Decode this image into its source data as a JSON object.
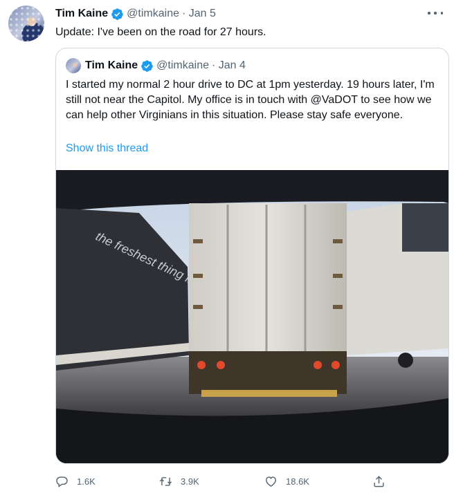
{
  "tweet": {
    "author_name": "Tim Kaine",
    "handle": "@timkaine",
    "date": "· Jan 5",
    "text": "Update: I've been on the road for 27 hours."
  },
  "quoted": {
    "author_name": "Tim Kaine",
    "handle": "@timkaine",
    "date": "· Jan 4",
    "text": "I started my normal 2 hour drive to DC at 1pm yesterday. 19 hours later, I'm still not near the Capitol. My office is in touch with @VaDOT to see how we can help other Virginians in this situation. Please stay safe everyone.",
    "link": "Show this thread",
    "image_text": "the freshest thing in fresh mushrooms"
  },
  "actions": {
    "replies": "1.6K",
    "retweets": "3.9K",
    "likes": "18.6K"
  },
  "icons": [
    "verified-badge-icon",
    "more-icon",
    "reply-icon",
    "retweet-icon",
    "like-icon",
    "share-icon"
  ],
  "colors": {
    "verified": "#1d9bf0",
    "link": "#1d9bf0",
    "muted": "#536471"
  }
}
